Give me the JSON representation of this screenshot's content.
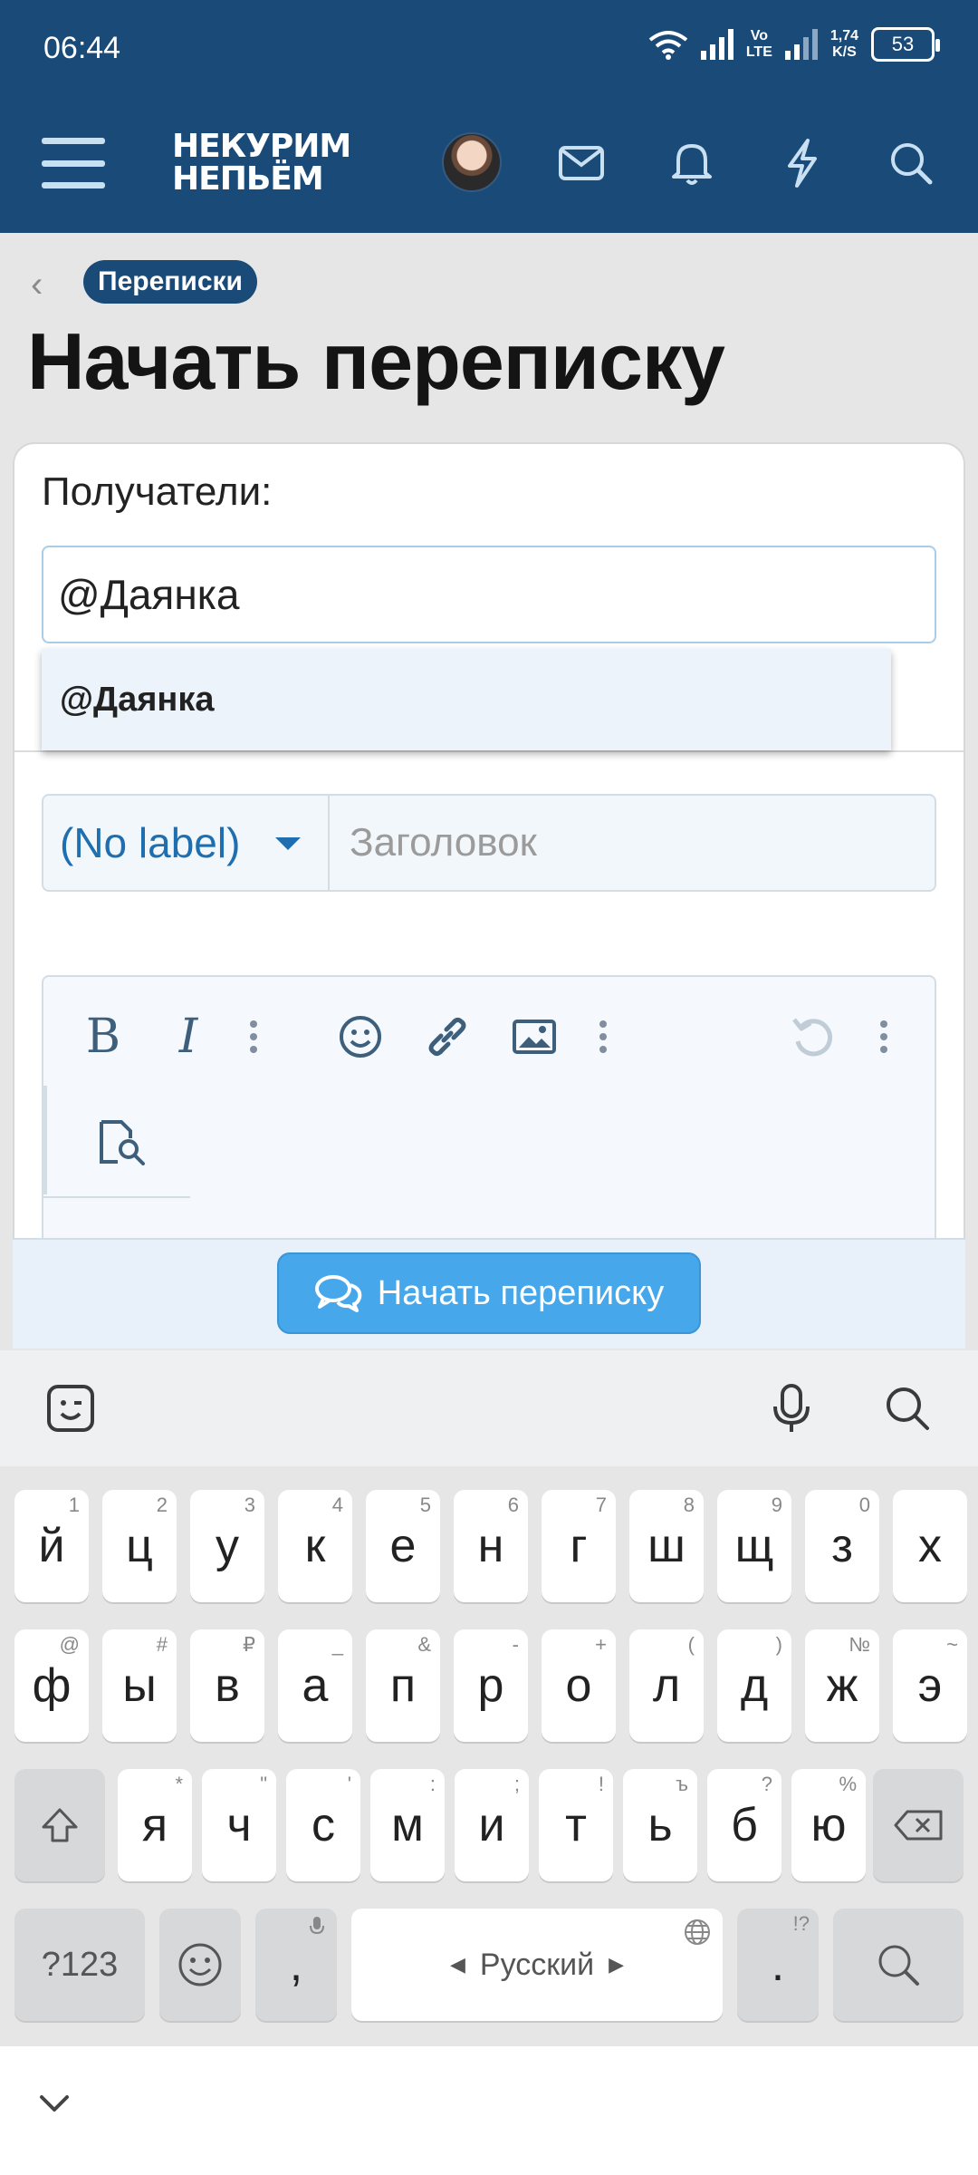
{
  "status": {
    "time": "06:44",
    "net_speed_top": "1,74",
    "net_speed_bottom": "K/S",
    "volte_top": "Vo",
    "volte_bottom": "LTE",
    "battery": "53"
  },
  "nav": {
    "logo_line1": "НЕКУРИМ",
    "logo_line2": "НЕПЬЁМ"
  },
  "breadcrumb": {
    "label": "Переписки"
  },
  "page": {
    "title": "Начать переписку"
  },
  "form": {
    "recipients_label": "Получатели:",
    "recipients_value": "@Даянка",
    "suggestion": "@Даянка",
    "prefix_label": "(No label)",
    "title_placeholder": "Заголовок",
    "submit_label": "Начать переписку"
  },
  "keyboard": {
    "row1": [
      {
        "k": "й",
        "h": "1"
      },
      {
        "k": "ц",
        "h": "2"
      },
      {
        "k": "у",
        "h": "3"
      },
      {
        "k": "к",
        "h": "4"
      },
      {
        "k": "е",
        "h": "5"
      },
      {
        "k": "н",
        "h": "6"
      },
      {
        "k": "г",
        "h": "7"
      },
      {
        "k": "ш",
        "h": "8"
      },
      {
        "k": "щ",
        "h": "9"
      },
      {
        "k": "з",
        "h": "0"
      },
      {
        "k": "х",
        "h": ""
      }
    ],
    "row2": [
      {
        "k": "ф",
        "h": "@"
      },
      {
        "k": "ы",
        "h": "#"
      },
      {
        "k": "в",
        "h": "₽"
      },
      {
        "k": "а",
        "h": "_"
      },
      {
        "k": "п",
        "h": "&"
      },
      {
        "k": "р",
        "h": "-"
      },
      {
        "k": "о",
        "h": "+"
      },
      {
        "k": "л",
        "h": "("
      },
      {
        "k": "д",
        "h": ")"
      },
      {
        "k": "ж",
        "h": "№"
      },
      {
        "k": "э",
        "h": "~"
      }
    ],
    "row3": [
      {
        "k": "я",
        "h": "*"
      },
      {
        "k": "ч",
        "h": "\""
      },
      {
        "k": "с",
        "h": "'"
      },
      {
        "k": "м",
        "h": ":"
      },
      {
        "k": "и",
        "h": ";"
      },
      {
        "k": "т",
        "h": "!"
      },
      {
        "k": "ь",
        "h": "ъ"
      },
      {
        "k": "б",
        "h": "?"
      },
      {
        "k": "ю",
        "h": "%"
      }
    ],
    "symbols_key": "?123",
    "comma_key": ",",
    "space_label": "Русский",
    "period_key": ".",
    "period_hint": "!?"
  }
}
